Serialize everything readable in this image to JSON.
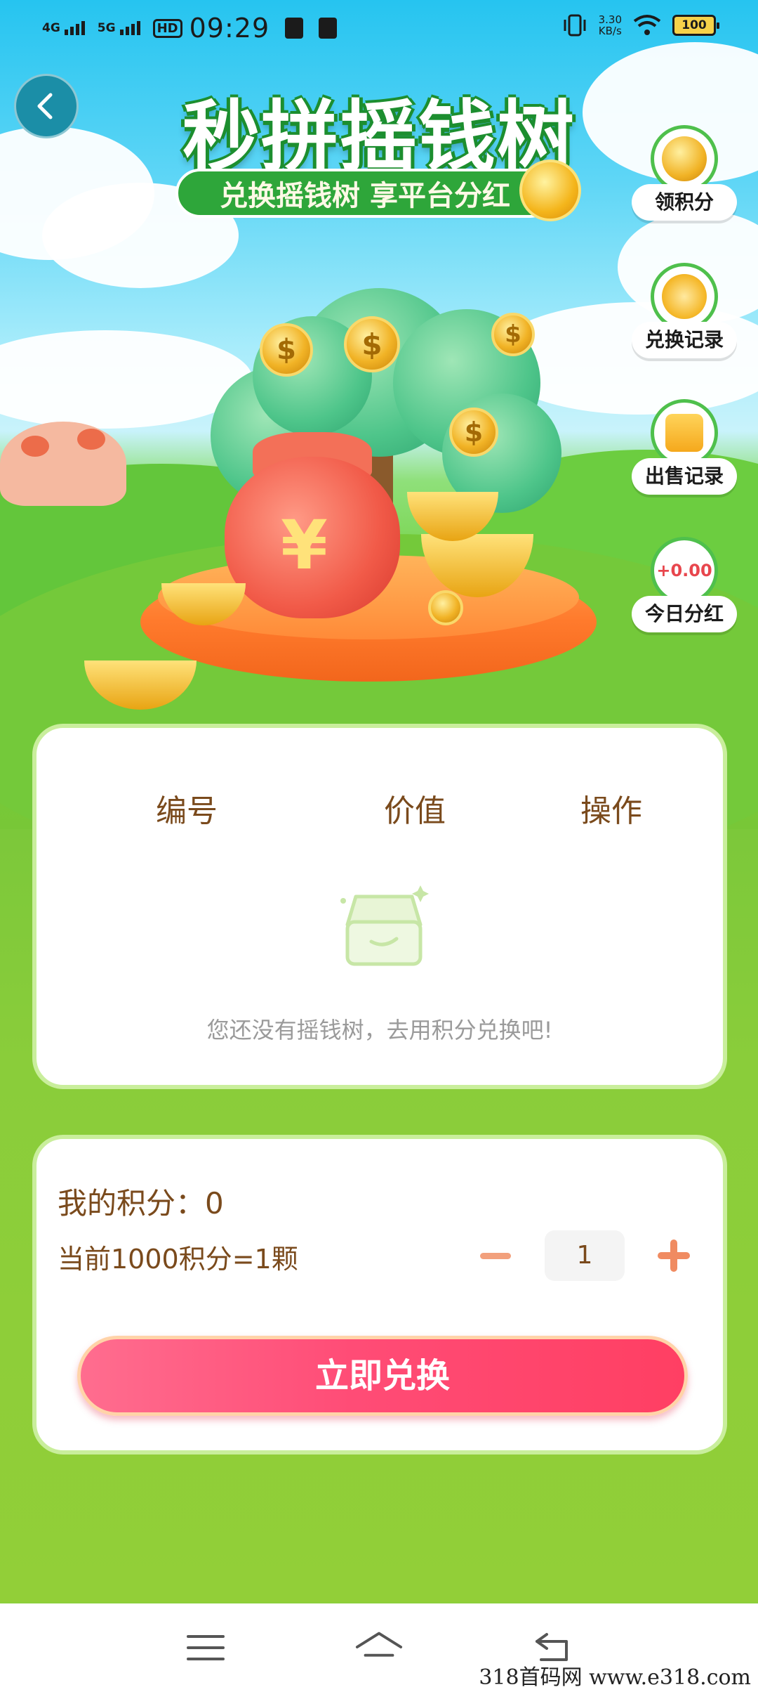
{
  "status_bar": {
    "net1": "4G",
    "net2": "5G",
    "hd": "HD",
    "time": "09:29",
    "speed_value": "3.30",
    "speed_unit": "KB/s",
    "battery": "100"
  },
  "header": {
    "title": "秒拼摇钱树",
    "subtitle": "兑换摇钱树 享平台分红"
  },
  "side_menu": {
    "earn_points": "领积分",
    "exchange_records": "兑换记录",
    "sale_records": "出售记录",
    "today_dividend_value": "+0.00",
    "today_dividend": "今日分红"
  },
  "tree_table": {
    "columns": [
      "编号",
      "价值",
      "操作"
    ],
    "empty_text": "您还没有摇钱树，去用积分兑换吧!"
  },
  "exchange": {
    "my_points": "我的积分：0",
    "rate": "当前1000积分=1颗",
    "quantity": "1",
    "button": "立即兑换"
  },
  "watermark": "318首码网 www.e318.com",
  "colors": {
    "accent": "#ff4c76",
    "text_brown": "#7a4a1c",
    "card_border": "#c9ee9c",
    "green": "#2ea63a"
  }
}
